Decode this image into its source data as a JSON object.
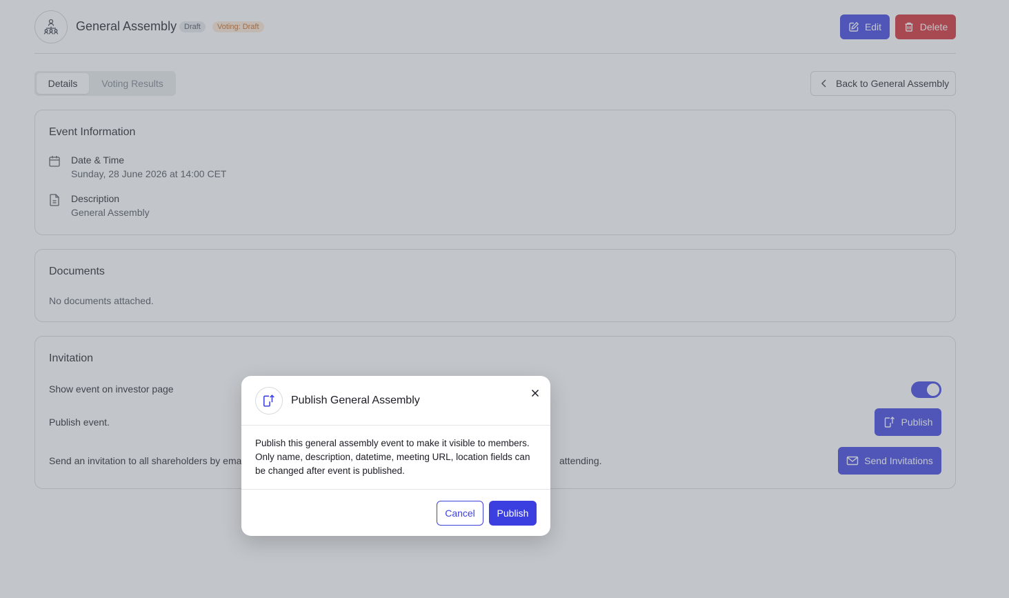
{
  "header": {
    "title": "General Assembly",
    "status_badge": "Draft",
    "voting_badge": "Voting: Draft",
    "edit_label": "Edit",
    "delete_label": "Delete"
  },
  "tabs": [
    {
      "label": "Details",
      "active": true
    },
    {
      "label": "Voting Results",
      "active": false
    }
  ],
  "back_button": "Back to General Assembly",
  "event_info": {
    "title": "Event Information",
    "date_label": "Date & Time",
    "date_value": "Sunday, 28 June 2026 at 14:00 CET",
    "desc_label": "Description",
    "desc_value": "General Assembly"
  },
  "documents": {
    "title": "Documents",
    "empty_text": "No documents attached."
  },
  "invitation": {
    "title": "Invitation",
    "show_label": "Show event on investor page",
    "show_enabled": true,
    "publish_text": "Publish event.",
    "publish_button": "Publish",
    "send_text_start": "Send an invitation to all shareholders by emai",
    "send_text_end": "attending.",
    "send_button": "Send Invitations"
  },
  "modal": {
    "title": "Publish General Assembly",
    "body": "Publish this general assembly event to make it visible to members. Only name, description, datetime, meeting URL, location fields can be changed after event is published.",
    "cancel_label": "Cancel",
    "confirm_label": "Publish"
  },
  "colors": {
    "primary": "#3b3fe0",
    "danger": "#d3262f",
    "overlay": "rgba(110,118,128,0.42)"
  }
}
